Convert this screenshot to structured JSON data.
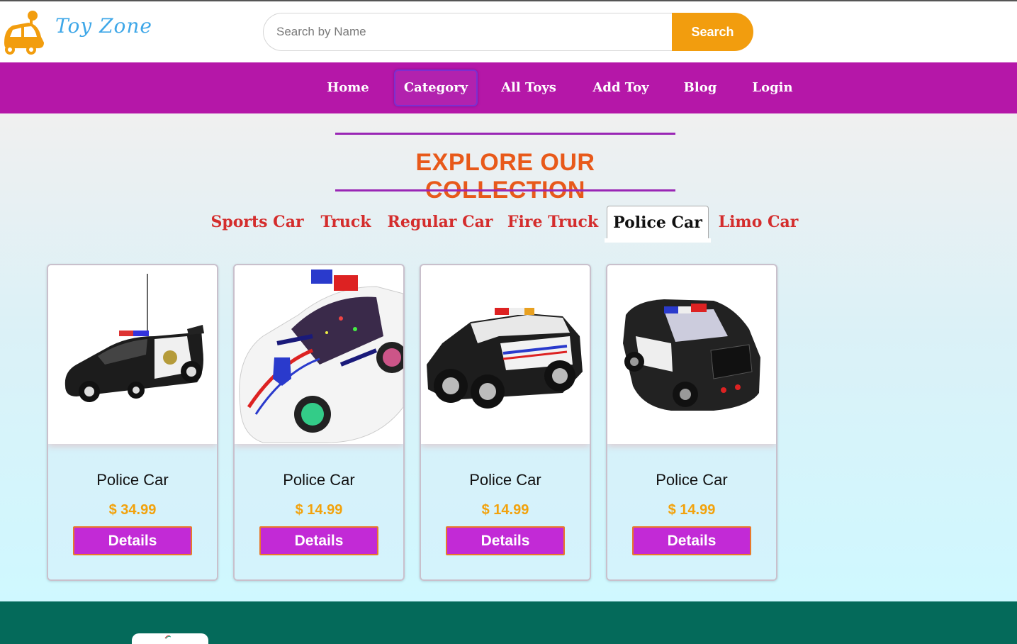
{
  "header": {
    "brand": "Toy Zone",
    "search_placeholder": "Search by Name",
    "search_button": "Search"
  },
  "nav": {
    "items": [
      {
        "label": "Home"
      },
      {
        "label": "Category",
        "active": true
      },
      {
        "label": "All Toys"
      },
      {
        "label": "Add Toy"
      },
      {
        "label": "Blog"
      },
      {
        "label": "Login"
      }
    ]
  },
  "collection": {
    "heading": "EXPLORE OUR COLLECTION",
    "tabs": [
      {
        "label": "Sports Car"
      },
      {
        "label": "Truck"
      },
      {
        "label": "Regular Car"
      },
      {
        "label": "Fire Truck"
      },
      {
        "label": "Police Car",
        "active": true
      },
      {
        "label": "Limo Car"
      }
    ]
  },
  "products": [
    {
      "name": "Police Car",
      "price": "$ 34.99",
      "button": "Details",
      "image": "rc-police-sports-car"
    },
    {
      "name": "Police Car",
      "price": "$ 14.99",
      "button": "Details",
      "image": "white-police-car"
    },
    {
      "name": "Police Car",
      "price": "$ 14.99",
      "button": "Details",
      "image": "police-suv"
    },
    {
      "name": "Police Car",
      "price": "$ 14.99",
      "button": "Details",
      "image": "black-police-car"
    }
  ],
  "colors": {
    "nav_bg": "#b517a8",
    "search_button": "#f29d0e",
    "heading": "#e8591a",
    "tab_text": "#d42d2d",
    "price": "#f2a20c",
    "details_button": "#c22ad6",
    "footer": "#046a5a"
  }
}
